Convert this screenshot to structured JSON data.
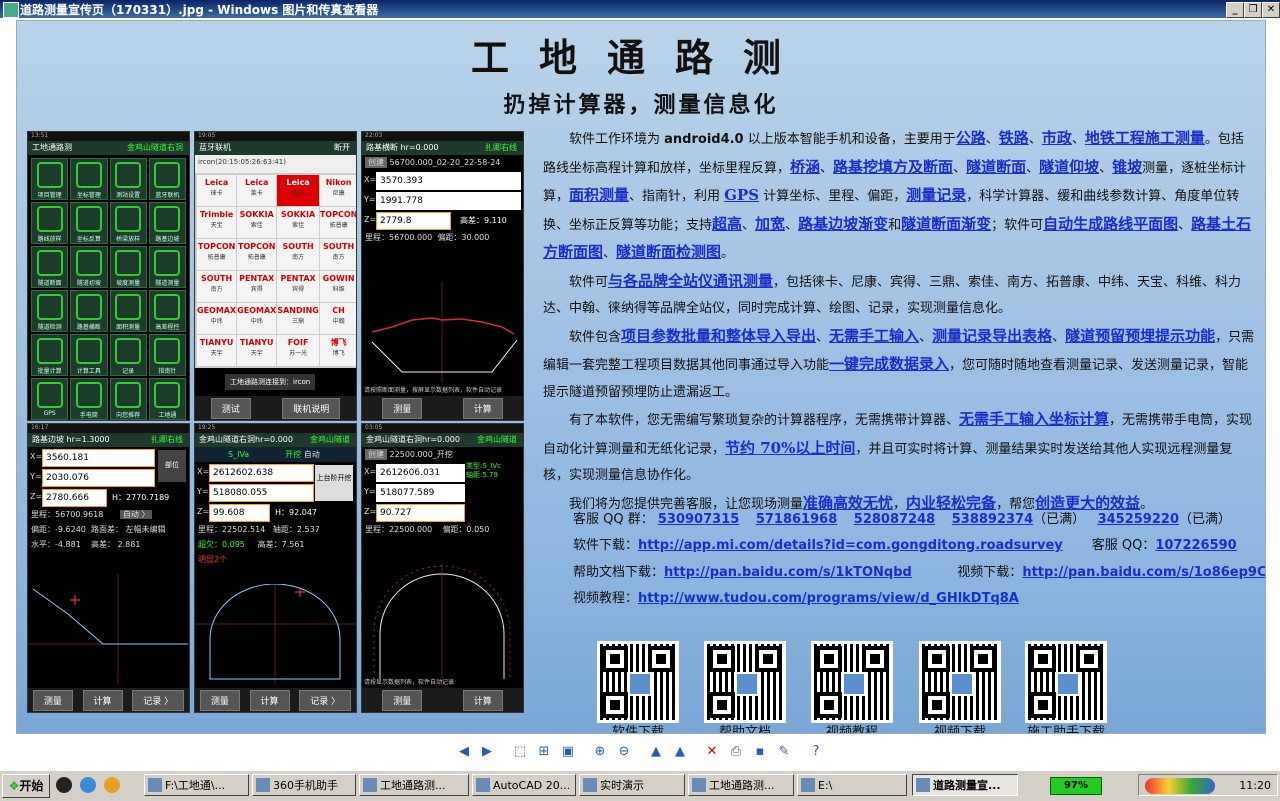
{
  "window": {
    "title": "道路测量宣传页（170331）.jpg - Windows 图片和传真查看器"
  },
  "poster": {
    "title": "工地通路测",
    "subtitle": "扔掉计算器，测量信息化",
    "phone1": {
      "status": "13:51",
      "header": "工地通路测",
      "header_right": "金鸡山隧道右洞",
      "items": [
        "项目管理",
        "坐标管理",
        "测站设置",
        "蓝牙联机",
        "路线放样",
        "坐标反算",
        "桥梁放样",
        "路基边坡",
        "隧道断面",
        "隧道初坡",
        "坡度测量",
        "隧道测量",
        "隧道检测",
        "路基横断",
        "面积测量",
        "高差程控",
        "批量计算",
        "计算工具",
        "记录",
        "指南针",
        "GPS",
        "手电筒",
        "向您推荐",
        "工地通"
      ]
    },
    "phone2": {
      "status": "19:05",
      "header": "蓝牙联机",
      "header_right": "断开",
      "device": "ircon(20:15:05:26:63:41)",
      "brands": [
        [
          "Leica",
          "徕卡"
        ],
        [
          "Leica",
          "莱卡"
        ],
        [
          "Leica",
          "徕卡"
        ],
        [
          "Nikon",
          "尼康"
        ],
        [
          "Trimble",
          "天宝"
        ],
        [
          "SOKKIA",
          "索佳"
        ],
        [
          "SOKKIA",
          "索佳"
        ],
        [
          "TOPCON",
          "拓普康"
        ],
        [
          "TOPCON",
          "拓普康"
        ],
        [
          "TOPCON",
          "拓普康"
        ],
        [
          "SOUTH",
          "南方"
        ],
        [
          "SOUTH",
          "南方"
        ],
        [
          "SOUTH",
          "南方"
        ],
        [
          "PENTAX",
          "宾得"
        ],
        [
          "PENTAX",
          "宾得"
        ],
        [
          "GOWIN",
          "科维"
        ],
        [
          "GEOMAX",
          "中纬"
        ],
        [
          "GEOMAX",
          "中纬"
        ],
        [
          "SANDING",
          "三鼎"
        ],
        [
          "CH",
          "中翰"
        ],
        [
          "TIANYU",
          "天宇"
        ],
        [
          "TIANYU",
          "天宇"
        ],
        [
          "FOIF",
          "苏一光"
        ],
        [
          "博飞",
          "博飞"
        ]
      ],
      "toast": "工地通路测连接到：ircon",
      "btn_left": "测试",
      "btn_right": "联机说明"
    },
    "phone3": {
      "status": "22:03",
      "header": "路基横断 hr=0.000",
      "header_right": "扎卿右线",
      "create": "创建",
      "name": "56700.000_02-20_22-58-24",
      "x": "3570.393",
      "y": "1991.778",
      "z": "2779.8",
      "elev": "高差：9.110",
      "mileage": "里程：56700.000",
      "offset": "偏距：30.000",
      "hint": "请按照断面测量，按屏显示数据列表，软件自动记录",
      "btn_left": "测量",
      "btn_right": "计算"
    },
    "phone4": {
      "status": "16:17",
      "header": "路基边坡 hr=1.3000",
      "header_right": "扎卿右线",
      "x": "3560.181",
      "y": "2030.076",
      "z": "2780.666",
      "h": "H：2770.7189",
      "side": "部位",
      "mileage": "里程：56700.9618",
      "auto": "自动 〉",
      "offset": "偏距：-9.6240",
      "surface": "路面差：",
      "left_note": "左幅未编辑",
      "horiz": "水平：-4.881",
      "elev": "高差：",
      "elev_val": "2.881",
      "btns": [
        "测量",
        "计算",
        "记录 〉"
      ]
    },
    "phone5": {
      "status": "19:25",
      "header": "金鸡山隧道右洞hr=0.000",
      "header_right": "金鸡山隧道",
      "mode": "S_IVa",
      "dig": "开挖",
      "auto": "自动",
      "x": "2612602.638",
      "y": "518080.055",
      "z": "99.608",
      "h": "H：92.047",
      "btn": "上台阶开挖",
      "mileage": "里程：22502.514",
      "axis": "轴距：2.537",
      "over": "超欠：0.095",
      "elev": "高差：7.561",
      "warn": "明显2个",
      "btns": [
        "测量",
        "计算",
        "记录 〉"
      ]
    },
    "phone6": {
      "status": "03:05",
      "header": "金鸡山隧道右洞hr=0.000",
      "header_right": "金鸡山隧道",
      "create": "创建",
      "name": "22500.000_开挖",
      "type": "类型:S_IVc",
      "axis2": "轴距:5.79",
      "x": "2612606.031",
      "y": "518077.589",
      "z": "90.727",
      "mileage": "里程：22500.000",
      "offset": "偏距：0.050",
      "hint": "请按显示数据列表，软件自动记录",
      "btn_left": "测量",
      "btn_right": "计算"
    },
    "desc": [
      [
        [
          "t",
          "软件工作环境为 "
        ],
        [
          "b",
          "android4.0"
        ],
        [
          "t",
          " 以上版本智能手机和设备，主要用于"
        ],
        [
          "h",
          "公路"
        ],
        [
          "t",
          "、"
        ],
        [
          "h",
          "铁路"
        ],
        [
          "t",
          "、"
        ],
        [
          "h",
          "市政"
        ],
        [
          "t",
          "、"
        ],
        [
          "h",
          "地铁工程施工测量"
        ],
        [
          "t",
          "。包括路线坐标高程计算和放样，坐标里程反算，"
        ],
        [
          "h",
          "桥涵"
        ],
        [
          "t",
          "、"
        ],
        [
          "h",
          "路基挖填方及断面"
        ],
        [
          "t",
          "、"
        ],
        [
          "h",
          "隧道断面"
        ],
        [
          "t",
          "、"
        ],
        [
          "h",
          "隧道仰坡"
        ],
        [
          "t",
          "、"
        ],
        [
          "h",
          "锥坡"
        ],
        [
          "t",
          "测量，逐桩坐标计算，"
        ],
        [
          "h",
          "面积测量"
        ],
        [
          "t",
          "、指南针，利用 "
        ],
        [
          "h",
          "GPS"
        ],
        [
          "t",
          " 计算坐标、里程、偏距，"
        ],
        [
          "h",
          "测量记录"
        ],
        [
          "t",
          "，科学计算器、缓和曲线参数计算、角度单位转换、坐标正反算等功能；支持"
        ],
        [
          "h",
          "超高"
        ],
        [
          "t",
          "、"
        ],
        [
          "h",
          "加宽"
        ],
        [
          "t",
          "、"
        ],
        [
          "h",
          "路基边坡渐变"
        ],
        [
          "t",
          "和"
        ],
        [
          "h",
          "隧道断面渐变"
        ],
        [
          "t",
          "；软件可"
        ],
        [
          "h",
          "自动生成路线平面图"
        ],
        [
          "t",
          "、"
        ],
        [
          "h",
          "路基土石方断面图"
        ],
        [
          "t",
          "、"
        ],
        [
          "h",
          "隧道断面检测图"
        ],
        [
          "t",
          "。"
        ]
      ],
      [
        [
          "t",
          "软件可"
        ],
        [
          "h",
          "与各品牌全站仪通讯测量"
        ],
        [
          "t",
          "，包括徕卡、尼康、宾得、三鼎、索佳、南方、拓普康、中纬、天宝、科维、科力达、中翰、徕纳得等品牌全站仪，同时完成计算、绘图、记录，实现测量信息化。"
        ]
      ],
      [
        [
          "t",
          "软件包含"
        ],
        [
          "h",
          "项目参数批量和整体导入导出"
        ],
        [
          "t",
          "、"
        ],
        [
          "h",
          "无需手工输入"
        ],
        [
          "t",
          "、"
        ],
        [
          "h",
          "测量记录导出表格"
        ],
        [
          "t",
          "、"
        ],
        [
          "h",
          "隧道预留预埋提示功能"
        ],
        [
          "t",
          "，只需编辑一套完整工程项目数据其他同事通过导入功能"
        ],
        [
          "h",
          "一键完成数据录入"
        ],
        [
          "t",
          "，您可随时随地查看测量记录、发送测量记录，智能提示隧道预留预埋防止遗漏返工。"
        ]
      ],
      [
        [
          "t",
          "有了本软件，您无需编写繁琐复杂的计算器程序，无需携带计算器、"
        ],
        [
          "h",
          "无需手工输入坐标计算"
        ],
        [
          "t",
          "，无需携带手电筒，实现自动化计算测量和无纸化记录，"
        ],
        [
          "h",
          "节约 70%以上时间"
        ],
        [
          "t",
          "，并且可实时将计算、测量结果实时发送给其他人实现远程测量复核，实现测量信息协作化。"
        ]
      ],
      [
        [
          "t",
          "我们将为您提供完善客服，让您现场测量"
        ],
        [
          "h",
          "准确高效无忧"
        ],
        [
          "t",
          "，"
        ],
        [
          "h",
          "内业轻松完备"
        ],
        [
          "t",
          "，帮您"
        ],
        [
          "h",
          "创造更大的效益"
        ],
        [
          "t",
          "。"
        ]
      ]
    ],
    "qq": {
      "label": "客服 QQ 群：",
      "groups": [
        "530907315",
        "571861968",
        "528087248",
        "538892374"
      ],
      "full1": "（已满）",
      "g5": "345259220",
      "full2": "（已满）"
    },
    "download": {
      "label": "软件下载：",
      "url": "http://app.mi.com/details?id=com.gongditong.roadsurvey",
      "qq_label": "客服 QQ：",
      "qq": "107226590"
    },
    "help": {
      "label": "帮助文档下载：",
      "url": "http://pan.baidu.com/s/1kTONqbd",
      "video_label": "视频下载：",
      "video_url": "http://pan.baidu.com/s/1o86ep9C"
    },
    "tutorial": {
      "label": "视频教程：",
      "url": "http://www.tudou.com/programs/view/d_GHlkDTq8A"
    },
    "qrcodes": [
      "软件下载",
      "帮助文档",
      "视频教程",
      "视频下载",
      "施工助手下载"
    ]
  },
  "toolbar": [
    "previous-icon",
    "next-icon",
    "best-fit-icon",
    "actual-size-icon",
    "slideshow-icon",
    "zoom-in-icon",
    "zoom-out-icon",
    "rotate-cw-icon",
    "rotate-ccw-icon",
    "delete-icon",
    "print-icon",
    "save-icon",
    "edit-icon",
    "help-icon"
  ],
  "taskbar": {
    "start": "开始",
    "tasks": [
      "F:\\工地通\\...",
      "360手机助手",
      "工地通路测...",
      "AutoCAD 20...",
      "实时演示",
      "工地通路测...",
      "E:\\",
      "道路测量宣..."
    ],
    "battery": "97%",
    "clock": "11:20"
  }
}
